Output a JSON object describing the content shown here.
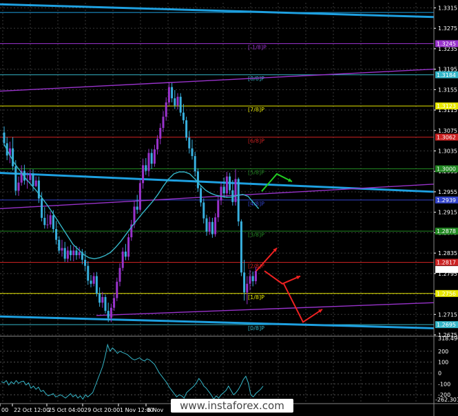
{
  "colors": {
    "background": "#000000",
    "grid": "#3a3a3a",
    "channel_cyan": "#1ea0e0",
    "channel_purple": "#9933cc",
    "bull_candle": "#9933cc",
    "bear_candle": "#38b0de",
    "ma": "#35b6c8",
    "cci": "#35b6c8",
    "arrow_green": "#22cc22",
    "arrow_red": "#ee2222"
  },
  "watermark": "www.instaforex.com",
  "chart_data": [
    {
      "type": "candlestick",
      "symbol_hidden": true,
      "ylim": [
        1.2675,
        1.3325
      ],
      "y_ticks": [
        "1.3315",
        "1.3275",
        "1.3235",
        "1.3195",
        "1.3155",
        "1.3115",
        "1.3075",
        "1.3035",
        "1.2995",
        "1.2955",
        "1.2915",
        "1.2875",
        "1.2835",
        "1.2795",
        "1.2755",
        "1.2715",
        "1.2675"
      ],
      "x_ticks": [
        "00",
        "22 Oct 12:00",
        "25 Oct 04:00",
        "29 Oct 20:00",
        "1 Nov 12:00",
        "6 Nov"
      ],
      "murrey_levels": [
        {
          "price": 1.3306,
          "label": "",
          "price_tag": "",
          "color": "#1ea0e0",
          "width": 1
        },
        {
          "price": 1.3245,
          "label": "[-1/8]P",
          "price_tag": "1.3245",
          "color": "#9933cc",
          "width": 1
        },
        {
          "price": 1.3184,
          "label": "[8/8]P",
          "price_tag": "1.3184",
          "color": "#35b6c8",
          "width": 1
        },
        {
          "price": 1.3123,
          "label": "[7/8]P",
          "price_tag": "1.3123",
          "color": "#e8e800",
          "width": 1
        },
        {
          "price": 1.3062,
          "label": "[6/8]P",
          "price_tag": "1.3062",
          "color": "#cc2222",
          "width": 1
        },
        {
          "price": 1.3,
          "label": "[5/8]P",
          "price_tag": "1.3000",
          "color": "#228822",
          "width": 1
        },
        {
          "price": 1.2939,
          "label": "[4/8]P",
          "price_tag": "1.2939",
          "color": "#3344cc",
          "width": 1
        },
        {
          "price": 1.2878,
          "label": "[3/8]P",
          "price_tag": "1.2878",
          "color": "#228822",
          "width": 1
        },
        {
          "price": 1.2817,
          "label": "[2/8]P",
          "price_tag": "1.2817",
          "color": "#cc2222",
          "width": 1
        },
        {
          "price": 1.2756,
          "label": "[1/8]P",
          "price_tag": "1.2756",
          "color": "#e8e800",
          "width": 1
        },
        {
          "price": 1.2695,
          "label": "[0/8]P",
          "price_tag": "1.2695",
          "color": "#35b6c8",
          "width": 1
        }
      ],
      "current_price": {
        "price": 1.2803,
        "label": "1.2803"
      },
      "channels": [
        {
          "name": "cyan-top",
          "color": "#1ea0e0",
          "x": [
            0,
            630
          ],
          "y": [
            1.3322,
            1.3297
          ]
        },
        {
          "name": "cyan-mid",
          "color": "#1ea0e0",
          "x": [
            0,
            630
          ],
          "y": [
            1.2992,
            1.2955
          ]
        },
        {
          "name": "cyan-bottom",
          "color": "#1ea0e0",
          "x": [
            0,
            630
          ],
          "y": [
            1.2711,
            1.2688
          ]
        },
        {
          "name": "purple-top",
          "color": "#9933cc",
          "x": [
            0,
            630
          ],
          "y": [
            1.3152,
            1.3195
          ]
        },
        {
          "name": "purple-mid",
          "color": "#9933cc",
          "x": [
            0,
            630
          ],
          "y": [
            1.2922,
            1.297
          ]
        },
        {
          "name": "purple-bottom",
          "color": "#9933cc",
          "x": [
            140,
            630
          ],
          "y": [
            1.2713,
            1.2738
          ]
        }
      ],
      "candles": [
        [
          1.3071,
          1.3083,
          1.3044,
          1.305
        ],
        [
          1.305,
          1.3062,
          1.3017,
          1.3026
        ],
        [
          1.3026,
          1.3053,
          1.3011,
          1.304
        ],
        [
          1.304,
          1.3062,
          1.2997,
          1.3005
        ],
        [
          1.3005,
          1.3017,
          1.2948,
          1.2957
        ],
        [
          1.2957,
          1.2985,
          1.2947,
          1.2973
        ],
        [
          1.2973,
          1.3007,
          1.2967,
          1.2996
        ],
        [
          1.2996,
          1.3008,
          1.2969,
          1.2977
        ],
        [
          1.2977,
          1.2993,
          1.2961,
          1.2978
        ],
        [
          1.2978,
          1.2999,
          1.2971,
          1.299
        ],
        [
          1.299,
          1.2999,
          1.2956,
          1.2966
        ],
        [
          1.2966,
          1.2985,
          1.2964,
          1.2977
        ],
        [
          1.2977,
          1.2985,
          1.2933,
          1.2942
        ],
        [
          1.2942,
          1.2954,
          1.2897,
          1.2904
        ],
        [
          1.2904,
          1.2925,
          1.2883,
          1.289
        ],
        [
          1.289,
          1.2911,
          1.2883,
          1.2891
        ],
        [
          1.2891,
          1.2917,
          1.2885,
          1.2909
        ],
        [
          1.2909,
          1.2919,
          1.2875,
          1.2882
        ],
        [
          1.2882,
          1.2898,
          1.2852,
          1.2861
        ],
        [
          1.2861,
          1.2868,
          1.2834,
          1.284
        ],
        [
          1.284,
          1.2861,
          1.2828,
          1.2845
        ],
        [
          1.2845,
          1.2857,
          1.2818,
          1.2824
        ],
        [
          1.2824,
          1.2848,
          1.2817,
          1.284
        ],
        [
          1.284,
          1.2851,
          1.282,
          1.2831
        ],
        [
          1.2831,
          1.2849,
          1.2819,
          1.284
        ],
        [
          1.284,
          1.2849,
          1.2822,
          1.2831
        ],
        [
          1.2831,
          1.2847,
          1.2824,
          1.2837
        ],
        [
          1.2837,
          1.2843,
          1.2813,
          1.2822
        ],
        [
          1.2822,
          1.2839,
          1.28,
          1.281
        ],
        [
          1.281,
          1.2819,
          1.2773,
          1.2781
        ],
        [
          1.2781,
          1.2792,
          1.2768,
          1.2775
        ],
        [
          1.2775,
          1.2797,
          1.277,
          1.279
        ],
        [
          1.279,
          1.2798,
          1.275,
          1.2756
        ],
        [
          1.2756,
          1.2768,
          1.273,
          1.2738
        ],
        [
          1.2738,
          1.2759,
          1.2728,
          1.2749
        ],
        [
          1.2749,
          1.2754,
          1.2717,
          1.2722
        ],
        [
          1.2722,
          1.2738,
          1.27,
          1.2708
        ],
        [
          1.2708,
          1.2736,
          1.27,
          1.2728
        ],
        [
          1.2728,
          1.2757,
          1.2722,
          1.2747
        ],
        [
          1.2747,
          1.2787,
          1.2741,
          1.2779
        ],
        [
          1.2779,
          1.2815,
          1.277,
          1.2806
        ],
        [
          1.2806,
          1.2846,
          1.28,
          1.2838
        ],
        [
          1.2838,
          1.2853,
          1.2821,
          1.2828
        ],
        [
          1.2828,
          1.2873,
          1.2821,
          1.2866
        ],
        [
          1.2866,
          1.29,
          1.2859,
          1.2891
        ],
        [
          1.2891,
          1.2937,
          1.2884,
          1.2926
        ],
        [
          1.2926,
          1.2949,
          1.2912,
          1.292
        ],
        [
          1.292,
          1.2979,
          1.2916,
          1.2972
        ],
        [
          1.2972,
          1.302,
          1.2961,
          1.3007
        ],
        [
          1.3007,
          1.3021,
          1.2988,
          1.2996
        ],
        [
          1.2996,
          1.3039,
          1.2985,
          1.3031
        ],
        [
          1.3031,
          1.3039,
          1.3,
          1.301
        ],
        [
          1.301,
          1.3047,
          1.3004,
          1.3038
        ],
        [
          1.3038,
          1.3066,
          1.3028,
          1.3059
        ],
        [
          1.3059,
          1.3089,
          1.3048,
          1.308
        ],
        [
          1.308,
          1.3113,
          1.3072,
          1.3102
        ],
        [
          1.3102,
          1.314,
          1.3094,
          1.313
        ],
        [
          1.313,
          1.317,
          1.3124,
          1.316
        ],
        [
          1.316,
          1.3168,
          1.313,
          1.3138
        ],
        [
          1.3138,
          1.3154,
          1.3117,
          1.3124
        ],
        [
          1.3124,
          1.3148,
          1.3116,
          1.3141
        ],
        [
          1.3141,
          1.3148,
          1.3103,
          1.311
        ],
        [
          1.311,
          1.3127,
          1.3088,
          1.3095
        ],
        [
          1.3095,
          1.3102,
          1.3055,
          1.3061
        ],
        [
          1.3061,
          1.3074,
          1.303,
          1.304
        ],
        [
          1.304,
          1.3057,
          1.3018,
          1.3025
        ],
        [
          1.3025,
          1.3033,
          1.2985,
          1.2995
        ],
        [
          1.2995,
          1.3001,
          1.2955,
          1.2962
        ],
        [
          1.2962,
          1.2968,
          1.2926,
          1.2934
        ],
        [
          1.2934,
          1.2942,
          1.2893,
          1.2903
        ],
        [
          1.2903,
          1.291,
          1.2869,
          1.2877
        ],
        [
          1.2877,
          1.2906,
          1.2871,
          1.2896
        ],
        [
          1.2896,
          1.2904,
          1.2865,
          1.2872
        ],
        [
          1.2872,
          1.2913,
          1.2867,
          1.2905
        ],
        [
          1.2905,
          1.2948,
          1.2896,
          1.2938
        ],
        [
          1.2938,
          1.2974,
          1.2929,
          1.2965
        ],
        [
          1.2965,
          1.2983,
          1.2943,
          1.2952
        ],
        [
          1.2952,
          1.2994,
          1.2944,
          1.2985
        ],
        [
          1.2985,
          1.2992,
          1.295,
          1.2958
        ],
        [
          1.2958,
          1.2978,
          1.2928,
          1.2935
        ],
        [
          1.2935,
          1.2999,
          1.2928,
          1.298
        ],
        [
          1.298,
          1.2983,
          1.2888,
          1.2897
        ],
        [
          1.2897,
          1.2901,
          1.279,
          1.2797
        ],
        [
          1.2797,
          1.2822,
          1.2742,
          1.2758
        ],
        [
          1.2758,
          1.279,
          1.2735,
          1.2775
        ],
        [
          1.2775,
          1.2802,
          1.2762,
          1.279
        ],
        [
          1.279,
          1.2799,
          1.277,
          1.278
        ],
        [
          1.278,
          1.2808,
          1.2774,
          1.28
        ]
      ],
      "ma": [
        1.3048,
        1.3028,
        1.301,
        1.2996,
        1.2982,
        1.297,
        1.2958,
        1.2945,
        1.2931,
        1.2916,
        1.29,
        1.2884,
        1.2868,
        1.2852,
        1.2842,
        1.2832,
        1.2826,
        1.2824,
        1.2826,
        1.283,
        1.2836,
        1.2846,
        1.2858,
        1.2872,
        1.2886,
        1.2899,
        1.2912,
        1.2924,
        1.2936,
        1.295,
        1.2966,
        1.298,
        1.299,
        1.2994,
        1.2994,
        1.299,
        1.298,
        1.2968,
        1.2958,
        1.2952,
        1.2948,
        1.2946,
        1.2944,
        1.2945,
        1.2948,
        1.295,
        1.2946,
        1.2934,
        1.2922
      ],
      "arrows": [
        {
          "color": "#22cc22",
          "points": [
            [
              1.2956,
              0
            ],
            [
              1.299,
              1
            ],
            [
              1.2975,
              2
            ]
          ]
        },
        {
          "color": "#ee2222",
          "points": [
            [
              1.28,
              0
            ],
            [
              1.2845,
              1
            ]
          ]
        },
        {
          "color": "#ee2222",
          "points": [
            [
              1.28,
              0
            ],
            [
              1.2775,
              1
            ],
            [
              1.279,
              2
            ]
          ]
        },
        {
          "color": "#ee2222",
          "points": [
            [
              1.2775,
              0
            ],
            [
              1.27,
              1
            ],
            [
              1.2725,
              2
            ]
          ]
        }
      ],
      "cci": {
        "y_ticks": [
          "318.4907",
          "200",
          "100",
          "0",
          "-100",
          "-200"
        ],
        "ylim": [
          -262.301,
          318.4907
        ],
        "min_label": "-262.301",
        "values": [
          -80,
          -90,
          -70,
          -110,
          -80,
          -100,
          -70,
          -95,
          -80,
          -75,
          -110,
          -90,
          -140,
          -120,
          -150,
          -130,
          -170,
          -160,
          -190,
          -210,
          -200,
          -190,
          -220,
          -210,
          -200,
          -215,
          -230,
          -210,
          -190,
          -220,
          -200,
          -230,
          -210,
          -240,
          -200,
          -220,
          -200,
          -180,
          -120,
          -60,
          0,
          60,
          150,
          260,
          200,
          230,
          210,
          180,
          200,
          190,
          180,
          170,
          150,
          130,
          120,
          130,
          140,
          120,
          110,
          130,
          120,
          100,
          80,
          40,
          0,
          -30,
          -60,
          -90,
          -130,
          -160,
          -190,
          -220,
          -200,
          -210,
          -230,
          -180,
          -160,
          -140,
          -120,
          -90,
          -50,
          -80,
          -120,
          -140,
          -170,
          -200,
          -240,
          -210,
          -230,
          -200,
          -180,
          -160,
          -120,
          -160,
          -200,
          -180,
          -150,
          -110,
          -60,
          -30,
          -90,
          -200,
          -220,
          -190,
          -170,
          -150,
          -120
        ]
      }
    }
  ]
}
